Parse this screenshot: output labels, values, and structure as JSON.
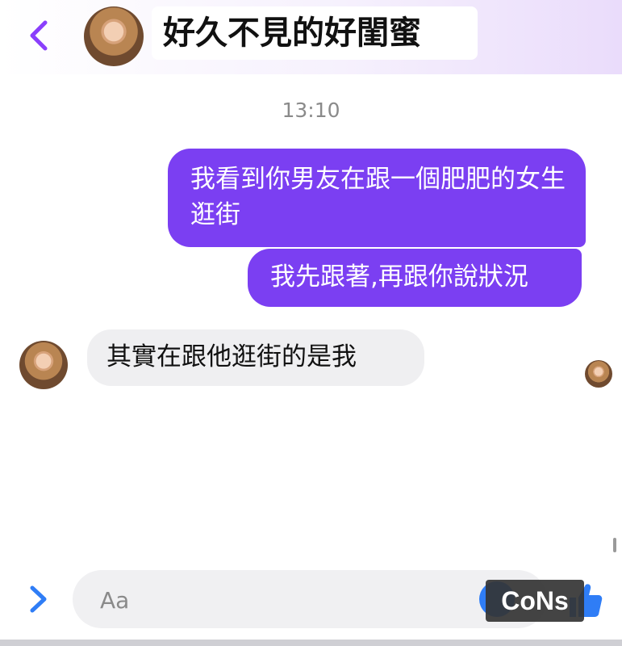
{
  "header": {
    "title": "好久不見的好閨蜜",
    "back_icon": "chevron-left-icon",
    "accent_color": "#8a3ffc"
  },
  "conversation": {
    "timestamp": "13:10",
    "messages": [
      {
        "sender": "me",
        "text": "我看到你男友在跟一個肥肥的女生逛街"
      },
      {
        "sender": "me",
        "text": "我先跟著,再跟你說狀況"
      },
      {
        "sender": "friend",
        "text": "其實在跟他逛街的是我"
      }
    ],
    "sent_bubble_color": "#7b3ff2",
    "received_bubble_color": "#efeff1"
  },
  "composer": {
    "placeholder": "Aa",
    "expand_icon": "chevron-right-icon",
    "emoji_icon": "emoji-icon",
    "like_icon": "thumbs-up-icon",
    "icon_color": "#2f7df6"
  },
  "watermark": {
    "text": "CoNs"
  }
}
